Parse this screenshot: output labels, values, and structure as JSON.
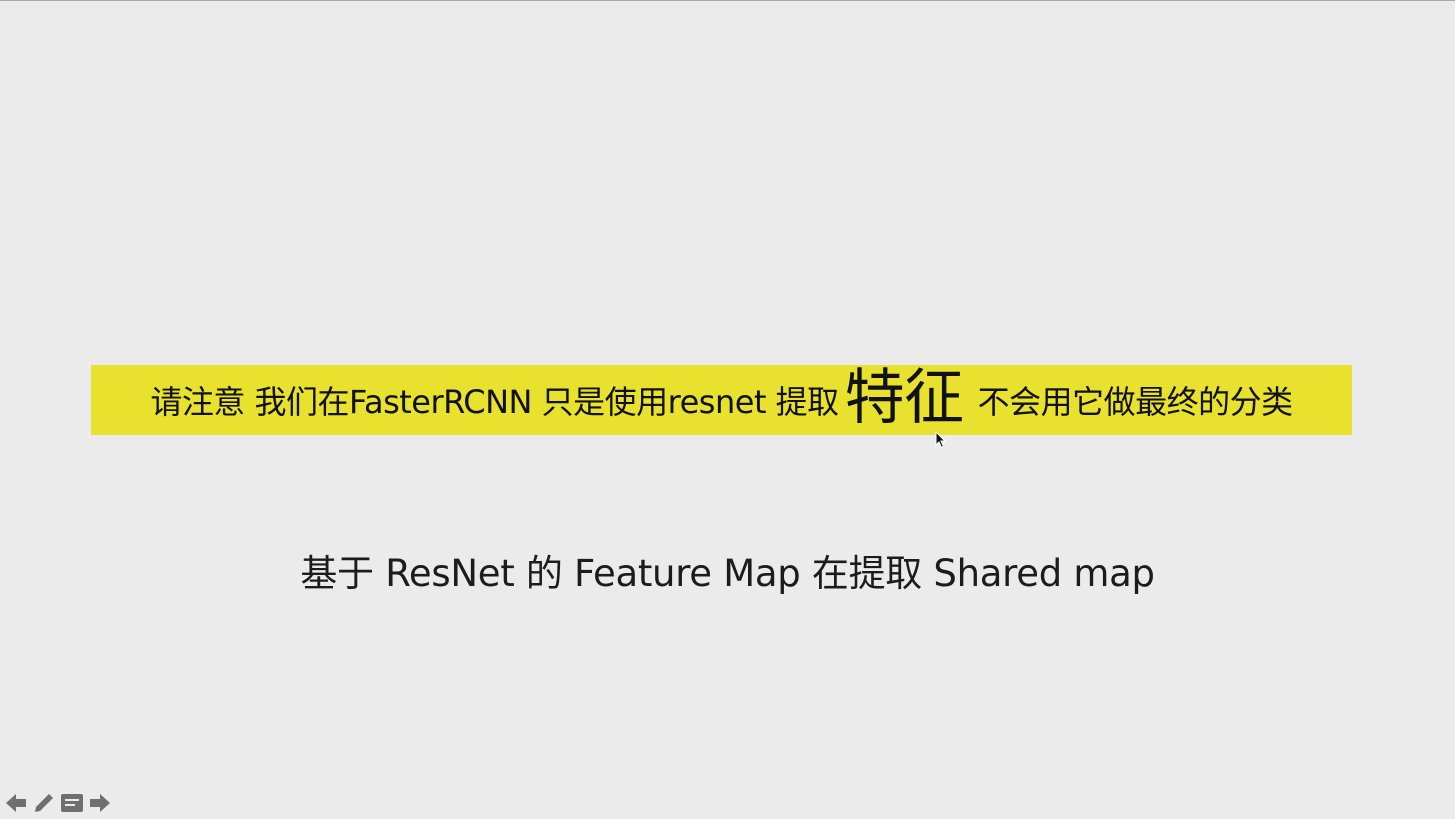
{
  "slide": {
    "highlight": {
      "part1": "请注意 我们在FasterRCNN 只是使用resnet 提取",
      "emphasis": "特征",
      "part2": "不会用它做最终的分类",
      "background_color": "#e8e22f"
    },
    "subtitle": "基于 ResNet 的 Feature Map 在提取 Shared map"
  },
  "controls": {
    "icons": [
      "arrow-left-icon",
      "pencil-icon",
      "menu-icon",
      "arrow-right-icon"
    ]
  },
  "colors": {
    "background": "#ebebeb",
    "icon": "#6f6f6f"
  }
}
